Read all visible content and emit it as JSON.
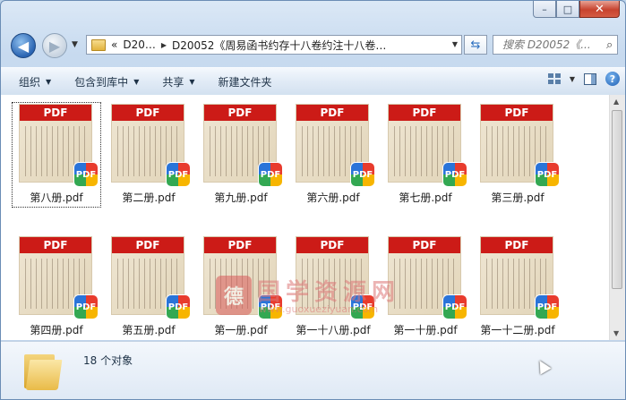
{
  "window": {
    "minimize": "–",
    "maximize": "□",
    "close": "✕"
  },
  "nav": {
    "back": "◀",
    "forward": "▶",
    "address_prefix": "«",
    "path_segments": [
      "D20…",
      "D20052《周易函书约存十八卷约注十八卷…"
    ],
    "search_placeholder": "搜索 D20052《..."
  },
  "toolbar": {
    "organize": "组织",
    "include_in_library": "包含到库中",
    "share": "共享",
    "new_folder": "新建文件夹",
    "help": "?"
  },
  "thumbnail_badge": "PDF",
  "app_badge": "PDF",
  "files": [
    {
      "name": "第八册.pdf",
      "selected": true
    },
    {
      "name": "第二册.pdf",
      "selected": false
    },
    {
      "name": "第九册.pdf",
      "selected": false
    },
    {
      "name": "第六册.pdf",
      "selected": false
    },
    {
      "name": "第七册.pdf",
      "selected": false
    },
    {
      "name": "第三册.pdf",
      "selected": false
    },
    {
      "name": "第四册.pdf",
      "selected": false
    },
    {
      "name": "第五册.pdf",
      "selected": false
    },
    {
      "name": "第一册.pdf",
      "selected": false
    },
    {
      "name": "第一十八册.pdf",
      "selected": false
    },
    {
      "name": "第一十册.pdf",
      "selected": false
    },
    {
      "name": "第一十二册.pdf",
      "selected": false
    }
  ],
  "watermark": {
    "logo": "德",
    "text": "国学资源网",
    "url": "www.guoxueziyuan.com"
  },
  "details": {
    "count": "18 个对象"
  }
}
